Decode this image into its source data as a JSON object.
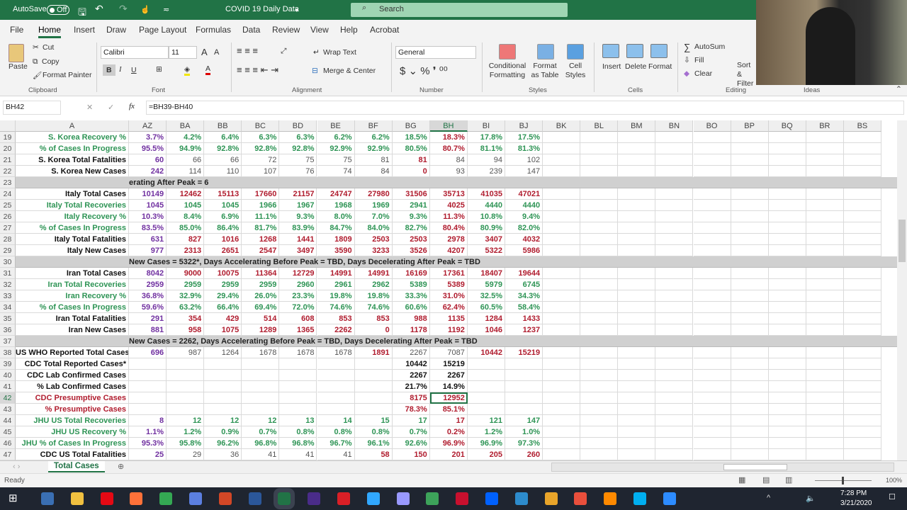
{
  "titlebar": {
    "autosave": "AutoSave",
    "autosave_state": "Off",
    "doc_title": "COVID 19 Daily Data",
    "search_placeholder": "Search"
  },
  "menu": [
    "File",
    "Home",
    "Insert",
    "Draw",
    "Page Layout",
    "Formulas",
    "Data",
    "Review",
    "View",
    "Help",
    "Acrobat"
  ],
  "ribbon": {
    "paste": "Paste",
    "cut": "Cut",
    "copy": "Copy",
    "format_painter": "Format Painter",
    "clipboard": "Clipboard",
    "font_name": "Calibri",
    "font_size": "11",
    "font": "Font",
    "bold": "B",
    "italic": "I",
    "underline": "U",
    "wrap_text": "Wrap Text",
    "merge_center": "Merge & Center",
    "alignment": "Alignment",
    "number_format": "General",
    "number": "Number",
    "conditional_formatting": "Conditional Formatting",
    "format_as_table": "Format as Table",
    "cell_styles": "Cell Styles",
    "styles": "Styles",
    "insert": "Insert",
    "delete": "Delete",
    "format": "Format",
    "cells": "Cells",
    "autosum": "AutoSum",
    "fill": "Fill",
    "clear": "Clear",
    "sort_filter": "Sort & Filter",
    "editing": "Editing",
    "ideas": "Ideas"
  },
  "formula_bar": {
    "name_box": "BH42",
    "formula": "=BH39-BH40"
  },
  "columns": [
    "A",
    "AZ",
    "BA",
    "BB",
    "BC",
    "BD",
    "BE",
    "BF",
    "BG",
    "BH",
    "BI",
    "BJ",
    "BK",
    "BL",
    "BM",
    "BN",
    "BO",
    "BP",
    "BQ",
    "BR",
    "BS"
  ],
  "rows": [
    {
      "n": "19",
      "label": "S. Korea Recovery %",
      "values": [
        "3.7%",
        "4.2%",
        "6.4%",
        "6.3%",
        "6.3%",
        "6.2%",
        "6.2%",
        "18.5%",
        "18.3%",
        "17.8%",
        "17.5%"
      ]
    },
    {
      "n": "20",
      "label": "% of Cases In Progress",
      "values": [
        "95.5%",
        "94.9%",
        "92.8%",
        "92.8%",
        "92.8%",
        "92.9%",
        "92.9%",
        "80.5%",
        "80.7%",
        "81.1%",
        "81.3%"
      ]
    },
    {
      "n": "21",
      "label": "S. Korea Total Fatalities",
      "values": [
        "60",
        "66",
        "66",
        "72",
        "75",
        "75",
        "81",
        "81",
        "84",
        "94",
        "102"
      ]
    },
    {
      "n": "22",
      "label": "S. Korea New Cases",
      "values": [
        "242",
        "114",
        "110",
        "107",
        "76",
        "74",
        "84",
        "0",
        "93",
        "239",
        "147"
      ]
    },
    {
      "n": "23",
      "banner": "erating After Peak = 6"
    },
    {
      "n": "24",
      "label": "Italy Total Cases",
      "values": [
        "10149",
        "12462",
        "15113",
        "17660",
        "21157",
        "24747",
        "27980",
        "31506",
        "35713",
        "41035",
        "47021"
      ]
    },
    {
      "n": "25",
      "label": "Italy Total Recoveries",
      "values": [
        "1045",
        "1045",
        "1045",
        "1966",
        "1967",
        "1968",
        "1969",
        "2941",
        "4025",
        "4440",
        "4440"
      ]
    },
    {
      "n": "26",
      "label": "Italy Recovery %",
      "values": [
        "10.3%",
        "8.4%",
        "6.9%",
        "11.1%",
        "9.3%",
        "8.0%",
        "7.0%",
        "9.3%",
        "11.3%",
        "10.8%",
        "9.4%"
      ]
    },
    {
      "n": "27",
      "label": "% of Cases In Progress",
      "values": [
        "83.5%",
        "85.0%",
        "86.4%",
        "81.7%",
        "83.9%",
        "84.7%",
        "84.0%",
        "82.7%",
        "80.4%",
        "80.9%",
        "82.0%"
      ]
    },
    {
      "n": "28",
      "label": "Italy Total Fatalities",
      "values": [
        "631",
        "827",
        "1016",
        "1268",
        "1441",
        "1809",
        "2503",
        "2503",
        "2978",
        "3407",
        "4032"
      ]
    },
    {
      "n": "29",
      "label": "Italy New Cases",
      "values": [
        "977",
        "2313",
        "2651",
        "2547",
        "3497",
        "3590",
        "3233",
        "3526",
        "4207",
        "5322",
        "5986"
      ]
    },
    {
      "n": "30",
      "banner": "New Cases = 5322*, Days Accelerating Before Peak = TBD, Days Decelerating After Peak = TBD"
    },
    {
      "n": "31",
      "label": "Iran Total Cases",
      "values": [
        "8042",
        "9000",
        "10075",
        "11364",
        "12729",
        "14991",
        "14991",
        "16169",
        "17361",
        "18407",
        "19644"
      ]
    },
    {
      "n": "32",
      "label": "Iran Total Recoveries",
      "values": [
        "2959",
        "2959",
        "2959",
        "2959",
        "2960",
        "2961",
        "2962",
        "5389",
        "5389",
        "5979",
        "6745"
      ]
    },
    {
      "n": "33",
      "label": "Iran Recovery %",
      "values": [
        "36.8%",
        "32.9%",
        "29.4%",
        "26.0%",
        "23.3%",
        "19.8%",
        "19.8%",
        "33.3%",
        "31.0%",
        "32.5%",
        "34.3%"
      ]
    },
    {
      "n": "34",
      "label": "% of Cases In Progress",
      "values": [
        "59.6%",
        "63.2%",
        "66.4%",
        "69.4%",
        "72.0%",
        "74.6%",
        "74.6%",
        "60.6%",
        "62.4%",
        "60.5%",
        "58.4%"
      ]
    },
    {
      "n": "35",
      "label": "Iran Total Fatalities",
      "values": [
        "291",
        "354",
        "429",
        "514",
        "608",
        "853",
        "853",
        "988",
        "1135",
        "1284",
        "1433"
      ]
    },
    {
      "n": "36",
      "label": "Iran New Cases",
      "values": [
        "881",
        "958",
        "1075",
        "1289",
        "1365",
        "2262",
        "0",
        "1178",
        "1192",
        "1046",
        "1237"
      ]
    },
    {
      "n": "37",
      "banner": "New Cases = 2262, Days Accelerating Before Peak = TBD, Days Decelerating After Peak = TBD"
    },
    {
      "n": "38",
      "label": "US WHO Reported Total Cases",
      "values": [
        "696",
        "987",
        "1264",
        "1678",
        "1678",
        "1678",
        "1891",
        "2267",
        "7087",
        "10442",
        "15219"
      ]
    },
    {
      "n": "39",
      "label": "CDC Total Reported Cases*",
      "values": [
        "",
        "",
        "",
        "",
        "",
        "",
        "",
        "10442",
        "15219",
        "",
        ""
      ]
    },
    {
      "n": "40",
      "label": "CDC Lab Confirmed Cases",
      "values": [
        "",
        "",
        "",
        "",
        "",
        "",
        "",
        "2267",
        "2267",
        "",
        ""
      ]
    },
    {
      "n": "41",
      "label": "% Lab Confirmed Cases",
      "values": [
        "",
        "",
        "",
        "",
        "",
        "",
        "",
        "21.7%",
        "14.9%",
        "",
        ""
      ]
    },
    {
      "n": "42",
      "label": "CDC Presumptive Cases",
      "values": [
        "",
        "",
        "",
        "",
        "",
        "",
        "",
        "8175",
        "12952",
        "",
        ""
      ]
    },
    {
      "n": "43",
      "label": "% Presumptive Cases",
      "values": [
        "",
        "",
        "",
        "",
        "",
        "",
        "",
        "78.3%",
        "85.1%",
        "",
        ""
      ]
    },
    {
      "n": "44",
      "label": "JHU US Total Recoveries",
      "values": [
        "8",
        "12",
        "12",
        "12",
        "13",
        "14",
        "15",
        "17",
        "17",
        "121",
        "147"
      ]
    },
    {
      "n": "45",
      "label": "JHU US Recovery %",
      "values": [
        "1.1%",
        "1.2%",
        "0.9%",
        "0.7%",
        "0.8%",
        "0.8%",
        "0.8%",
        "0.7%",
        "0.2%",
        "1.2%",
        "1.0%"
      ]
    },
    {
      "n": "46",
      "label": "JHU % of Cases In Progress",
      "values": [
        "95.3%",
        "95.8%",
        "96.2%",
        "96.8%",
        "96.8%",
        "96.7%",
        "96.1%",
        "92.6%",
        "96.9%",
        "96.9%",
        "97.3%"
      ]
    },
    {
      "n": "47",
      "label": "CDC US Total Fatalities",
      "values": [
        "25",
        "29",
        "36",
        "41",
        "41",
        "41",
        "58",
        "150",
        "201",
        "205",
        "260"
      ]
    }
  ],
  "sheet_tab": "Total Cases",
  "status": {
    "ready": "Ready",
    "zoom": "100%"
  },
  "clock": {
    "time": "7:28 PM",
    "date": "3/21/2020"
  }
}
